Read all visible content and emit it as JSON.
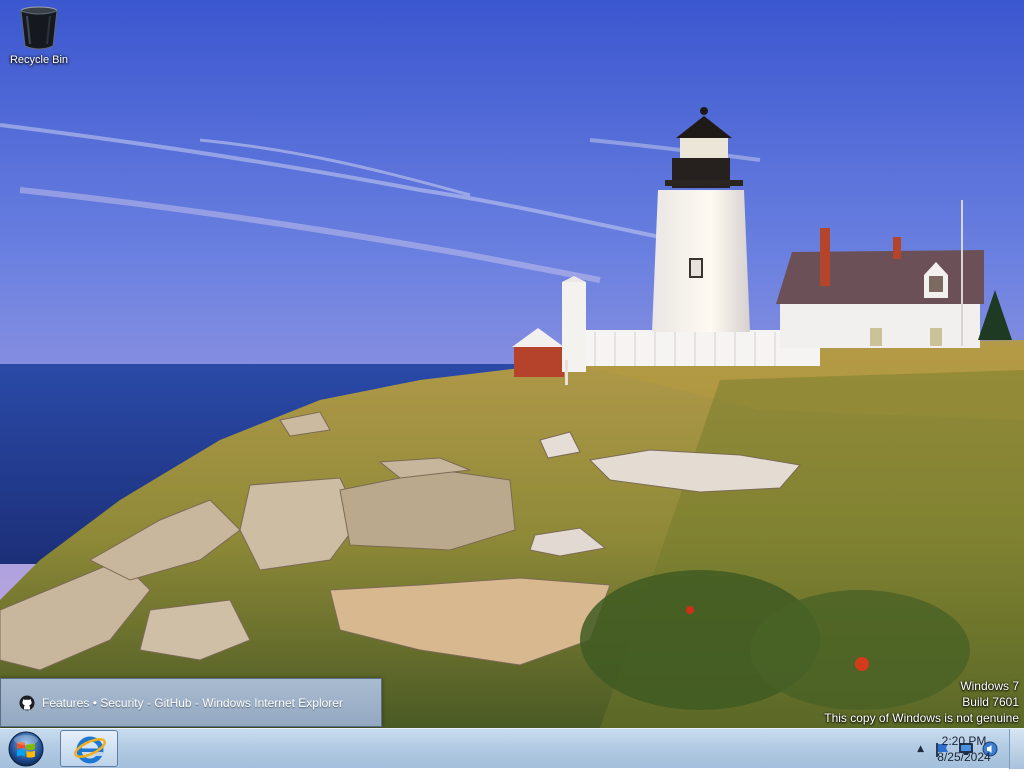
{
  "desktop": {
    "icons": [
      {
        "label": "Recycle Bin",
        "icon": "recycle-bin-icon"
      }
    ]
  },
  "watermark": {
    "line1": "Windows 7",
    "line2": "Build 7601",
    "line3": "This copy of Windows is not genuine"
  },
  "taskbar": {
    "start_icon": "windows-start-icon",
    "pinned_app_icon": "internet-explorer-icon",
    "thumbnail": {
      "icon": "github-icon",
      "title": "Features • Security - GitHub - Windows Internet Explorer"
    },
    "tray": {
      "icons": [
        "show-hidden-icons-arrow",
        "action-center-flag-icon",
        "network-monitor-icon",
        "volume-icon"
      ]
    },
    "clock": {
      "time": "2:20 PM",
      "date": "8/25/2024"
    }
  },
  "colors": {
    "taskbar": "#b3cbe3",
    "thumbnail": "#a9bbd0",
    "sky_top": "#3d5bd0",
    "sea": "#243f9c"
  }
}
